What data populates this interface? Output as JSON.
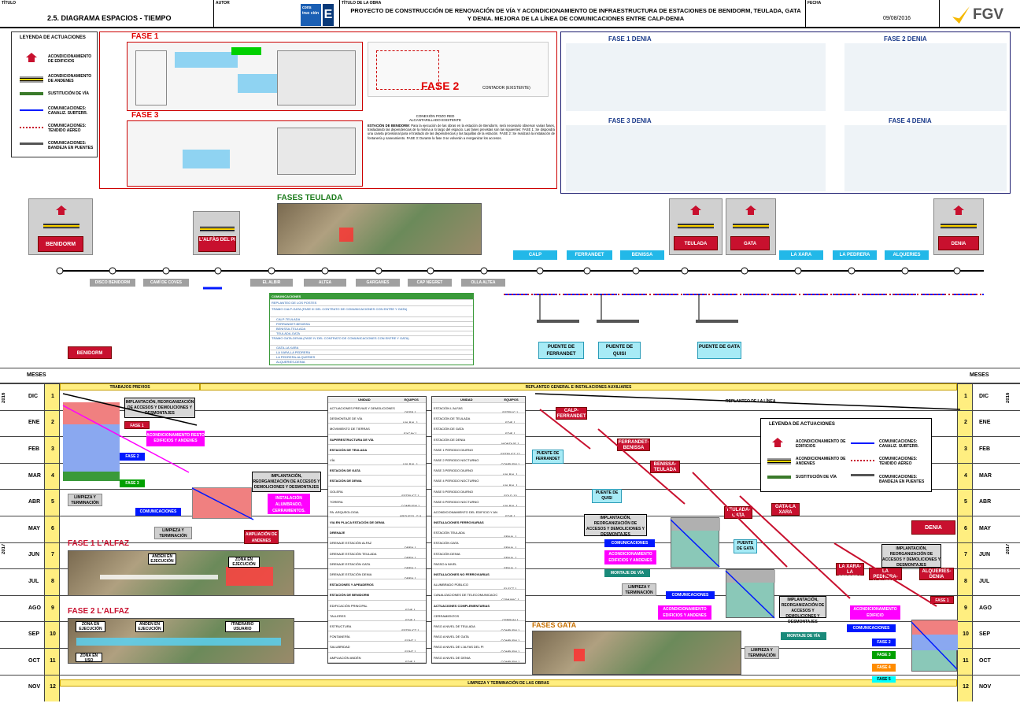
{
  "header": {
    "titulo_label": "TÍTULO",
    "titulo": "2.5. DIAGRAMA ESPACIOS - TIEMPO",
    "autor_label": "AUTOR",
    "logo_text": "cons truc ción",
    "obra_label": "TÍTULO DE LA OBRA",
    "obra": "PROYECTO DE CONSTRUCCIÓN DE RENOVACIÓN DE VÍA Y ACONDICIONAMIENTO DE INFRAESTRUCTURA DE ESTACIONES DE BENIDORM, TEULADA, GATA Y DENIA. MEJORA DE LA LÍNEA DE COMUNICACIONES ENTRE CALP-DENIA",
    "fecha_label": "FECHA",
    "fecha": "09/08/2016",
    "brand": "FGV"
  },
  "legend_top": {
    "title": "LEYENDA DE ACTUACIONES",
    "items": [
      "ACONDICIONAMIENTO DE EDIFICIOS",
      "ACONDICIONAMIENTO DE ANDENES",
      "SUSTITUCIÓN DE VÍA",
      "COMUNICACIONES: CANALIZ. SUBTERR.",
      "COMUNICACIONES: TENDIDO AÉREO",
      "COMUNICACIONES: BANDEJA EN PUENTES"
    ]
  },
  "benidorm_plan": {
    "fase1": "FASE 1",
    "fase2": "FASE 2",
    "fase3": "FASE 3",
    "contador": "CONTADOR (EXISTENTE)",
    "conexion": "CONEXIÓN POZO RED ALCANTARILLADO EXISTENTE",
    "desc_title": "ESTACIÓN DE BENIDORM",
    "desc": "Para la ejecución de las obras en la estación de Benidorm, será necesario observar varias fases, trasladando las dependencias de la misma a lo largo del espacio. Las fases previstas son las siguientes: FASE 1: Se dispondrá una caseta provisional para el traslado de las dependencias y las taquillas de la estación. FASE 2: Se realizará la instalación de fontanería y saneamiento. FASE 3: Durante la fase 3 se volverán a reorganizar los accesos."
  },
  "denia_plans": {
    "fase1": "FASE 1 DENIA",
    "fase2": "FASE 2 DENIA",
    "fase3": "FASE 3 DENIA",
    "fase4": "FASE 4 DENIA"
  },
  "stations": {
    "benidorm": "BENIDORM",
    "alfas": "L'ALFÀS DEL PI",
    "teulada": "TEULADA",
    "gata": "GATA",
    "denia": "DENIA",
    "calp": "CALP",
    "ferrandet": "FERRANDET",
    "benissa": "BENISSA",
    "xara": "LA XARA",
    "pedrera": "LA PEDRERA",
    "alqueries": "ALQUERIES"
  },
  "gray_stops": [
    "DISCO BENIDORM",
    "CAMÍ DE COVES",
    "EL ALBIR",
    "ALTEA",
    "GARGANES",
    "CAP NEGRET",
    "OLLA ALTEA"
  ],
  "fases_teulada": "FASES TEULADA",
  "fases_gata": "FASES GATA",
  "puentes": [
    "PUENTE DE FERRANDET",
    "PUENTE DE QUISI",
    "PUENTE DE GATA"
  ],
  "comms_table": {
    "rows": [
      "COMUNICACIONES",
      "REPLANTEO DE LOS POSTES",
      "TRAMO CALP-GATA (FASE III DEL CONTRATO DE COMUNICACIONES CON ENTRE Y GATA)",
      "CALP-TEULADA",
      "FERRANDET-BENISSA",
      "BENISSA-TEULADA",
      "TEULADA-GATA",
      "TRAMO GATA-DENIA (FASE IV DEL CONTRATO DE COMUNICACIONES CON ENTRE Y GATA)",
      "GATA-LA XARA",
      "LA XARA-LA PEDRERA",
      "LA PEDRERA-ALQUERIES",
      "ALQUERIES-DENIA"
    ]
  },
  "gantt": {
    "meses": "MESES",
    "years": [
      "2016",
      "2017"
    ],
    "months": [
      {
        "name": "DIC",
        "num": "1"
      },
      {
        "name": "ENE",
        "num": "2"
      },
      {
        "name": "FEB",
        "num": "3"
      },
      {
        "name": "MAR",
        "num": "4"
      },
      {
        "name": "ABR",
        "num": "5"
      },
      {
        "name": "MAY",
        "num": "6"
      },
      {
        "name": "JUN",
        "num": "7"
      },
      {
        "name": "JUL",
        "num": "8"
      },
      {
        "name": "AGO",
        "num": "9"
      },
      {
        "name": "SEP",
        "num": "10"
      },
      {
        "name": "OCT",
        "num": "11"
      },
      {
        "name": "NOV",
        "num": "12"
      }
    ],
    "trabajos_previos": "TRABAJOS PREVIOS",
    "replanteo": "REPLANTEO GENERAL E INSTALACIONES AUXILIARES",
    "replanteo_linea": "REPLANTEO DE LA LÍNEA",
    "limpieza_final": "LIMPIEZA Y TERMINACIÓN DE LAS OBRAS",
    "benidorm": "BENIDORM",
    "implantacion": "IMPLANTACIÓN, REORGANIZACIÓN DE ACCESOS Y DEMOLICIONES Y DESMONTAJES",
    "fase1": "FASE 1",
    "fase2": "FASE 2",
    "fase3": "FASE 3",
    "fase4": "FASE 4",
    "fase5": "FASE 5",
    "acond_resto": "ACONDICIONAMIENTO RESTO EDIFICIOS Y ANDENES",
    "limpieza": "LIMPIEZA Y TERMINACIÓN",
    "comunicaciones": "COMUNICACIONES",
    "instal_alumbrado": "INSTALACIÓN ALUMBRADO, CERRAMIENTOS.",
    "ampliacion_andenes": "AMPLIACIÓN DE ANDENES",
    "fase1_alfaz": "FASE 1 L'ALFAZ",
    "fase2_alfaz": "FASE 2 L'ALFAZ",
    "anden_ejec": "ANDÉN EN EJECUCIÓN",
    "zona_ejec": "ZONA EN EJECUCIÓN",
    "zona_uso": "ZONA EN USO",
    "itinerario": "ITINERARIO USUARIO",
    "acond_edificio": "ACONDICIONAMIENTO EDIFICIO",
    "acond_edif_andenes": "ACONDICIONAMIENTO EDIFICIOS Y ANDENES",
    "montaje_via": "MONTAJE DE VÍA",
    "calp_ferrandet": "CALP-FERRANDET",
    "ferrandet_benissa": "FERRANDET-BENISSA",
    "benissa_teulada": "BENISSA-TEULADA",
    "teulada_gata": "TEULADA-GATA",
    "gata_xara": "GATA-LA XARA",
    "xara_pedrera": "LA XARA-LA PEDRERA",
    "pedrera_alqueries": "LA PEDRERA-ALQUERIES",
    "alqueries_denia": "ALQUERIES-DENIA",
    "puente_ferrandet": "PUENTE DE FERRANDET",
    "puente_quisi": "PUENTE DE QUISI",
    "puente_gata": "PUENTE DE GATA",
    "denia": "DENIA"
  },
  "legend_bottom": {
    "title": "LEYENDA DE ACTUACIONES",
    "items": [
      "ACONDICIONAMIENTO DE EDIFICIOS",
      "ACONDICIONAMIENTO DE ANDENES",
      "SUSTITUCIÓN DE VÍA",
      "COMUNICACIONES: CANALIZ. SUBTERR.",
      "COMUNICACIONES: TENDIDO AÉREO",
      "COMUNICACIONES: BANDEJA EN PUENTES"
    ]
  },
  "mid_table1": {
    "head": [
      "UNIDAD",
      "EQUIPOS"
    ],
    "rows": [
      [
        "ACTUACIONES PREVIAS Y DEMOLICIONES",
        "DESB-1"
      ],
      [
        "DESMONTAJE DE VÍA",
        "VIA-BAL-1"
      ],
      [
        "MOVIMIENTO DE TIERRAS",
        "EXCAV-1"
      ],
      [
        "SUPERESTRUCTURA DE VÍA",
        ""
      ],
      [
        "ESTACIÓN DE TEULADA",
        ""
      ],
      [
        "VÍA",
        "VIA-BAL-1"
      ],
      [
        "ESTACIÓN DE GATA",
        ""
      ],
      [
        "ESTACIÓN DE DENIA",
        ""
      ],
      [
        "GOLERA",
        "ESTRUCT-1"
      ],
      [
        "TORERA",
        "COMPLEM-1"
      ],
      [
        "PA. ARQUEOLOGIA",
        "ARQUEOL-G-9"
      ],
      [
        "VIA EN PLACA ESTACIÓN DE DENIA",
        ""
      ],
      [
        "DRENAJE",
        ""
      ],
      [
        "DRENAJE ESTACIÓN ALFAZ",
        "DREN-1"
      ],
      [
        "DRENAJE ESTACIÓN TEULADA",
        "DREN-1"
      ],
      [
        "DRENAJE ESTACIÓN GATA",
        "DREN-1"
      ],
      [
        "DRENAJE ESTACIÓN DENIA",
        "DREN-1"
      ],
      [
        "ESTACIONES Y APEADEROS",
        ""
      ],
      [
        "ESTACIÓN DE BENIDORM",
        ""
      ],
      [
        "EDIFICACIÓN PRINCIPAL",
        "EDIF-1"
      ],
      [
        "TALLERES",
        "EDIF-1"
      ],
      [
        "ESTRUCTURA",
        "ESTRUCT-1"
      ],
      [
        "FONTANERÍA",
        "FONT-1"
      ],
      [
        "SALUBRIDAD",
        "FONT-1"
      ],
      [
        "AMPLIACIÓN ANDÉN",
        "EDIF-1"
      ]
    ]
  },
  "mid_table2": {
    "head": [
      "UNIDAD",
      "EQUIPOS"
    ],
    "rows": [
      [
        "ESTACIÓN L'ALFAS",
        "ESTRUC-1"
      ],
      [
        "ESTACIÓN DE TEULADA",
        "EDIF-1"
      ],
      [
        "ESTACIÓN DE GATA",
        "EDIF-1"
      ],
      [
        "ESTACIÓN DE DENIA",
        "MONTAJE-1"
      ],
      [
        "FASE 1 PERIODO DIURNO",
        "ESTRUCT-12"
      ],
      [
        "FASE 2 PERIODO NOCTURNO",
        "COMPLEM-1"
      ],
      [
        "FASE 3 PERIODO DIURNO",
        "VIA-BAL-1"
      ],
      [
        "FASE 4 PERIODO NOCTURNO",
        "VIA-BAL-1"
      ],
      [
        "FASE 5 PERIODO DIURNO",
        "SOLD-10"
      ],
      [
        "FASE 6 PERIODO NOCTURNO",
        "VIA-BAL-1"
      ],
      [
        "ACONDICIONAMIENTO DEL EDIFICIO Y ANDENES",
        "EDIF-1"
      ],
      [
        "INSTALACIONES FERROVIARIAS",
        ""
      ],
      [
        "ESTACIÓN TEULADA",
        "SENAL-1"
      ],
      [
        "ESTACIÓN GATA",
        "SENAL-1"
      ],
      [
        "ESTACIÓN DENIA",
        "SENAL-1"
      ],
      [
        "PASSO A NIVEL",
        "SENAL-1"
      ],
      [
        "INSTALACIONES NO FERROVIARIAS",
        ""
      ],
      [
        "ALUMBRADO PÚBLICO",
        "ELECT-1"
      ],
      [
        "CANALIZACIONES DE TELECOMUNICACIONES",
        "COMUNIC-1"
      ],
      [
        "ACTUACIONES COMPLEMENTARIAS",
        ""
      ],
      [
        "CERRAMIENTOS",
        "CERRAM-1"
      ],
      [
        "PASO A NIVEL DE TEULADA",
        "COMPLEM-1"
      ],
      [
        "PASO A NIVEL DE GATA",
        "COMPLEM-1"
      ],
      [
        "PASO A NIVEL DE L'ALFAS DEL PI",
        "COMPLEM-1"
      ],
      [
        "PASO A NIVEL DE DENIA",
        "COMPLEM-1"
      ]
    ]
  },
  "colors": {
    "red": "#c8102e",
    "cyan": "#22b8e8",
    "blue": "#0019ff",
    "magenta": "#ff00ff",
    "teal": "#1a8a7a",
    "green": "#00a000"
  }
}
